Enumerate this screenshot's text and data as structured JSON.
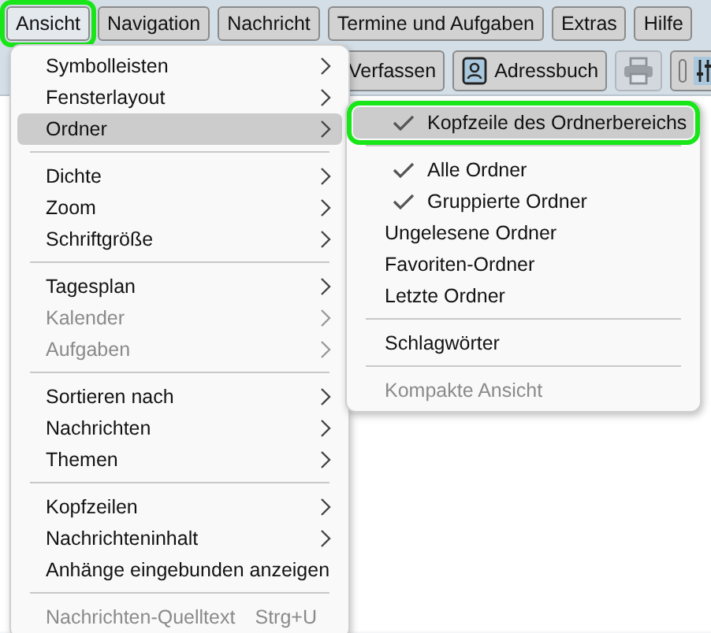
{
  "menubar": [
    {
      "label": "Ansicht",
      "selected": true,
      "outlined": true
    },
    {
      "label": "Navigation",
      "selected": false,
      "outlined": false
    },
    {
      "label": "Nachricht",
      "selected": false,
      "outlined": false
    },
    {
      "label": "Termine und Aufgaben",
      "selected": false,
      "outlined": false
    },
    {
      "label": "Extras",
      "selected": false,
      "outlined": false
    },
    {
      "label": "Hilfe",
      "selected": false,
      "outlined": false
    }
  ],
  "toolbar": [
    {
      "kind": "text",
      "label": "Verfassen",
      "disabled": false
    },
    {
      "kind": "addressbook",
      "label": "Adressbuch",
      "disabled": false
    },
    {
      "kind": "print",
      "disabled": true
    },
    {
      "kind": "filters",
      "disabled": false
    }
  ],
  "menu": [
    {
      "kind": "item",
      "label": "Symbolleisten",
      "submenu": true,
      "disabled": false,
      "selected": false
    },
    {
      "kind": "item",
      "label": "Fensterlayout",
      "submenu": true,
      "disabled": false,
      "selected": false
    },
    {
      "kind": "item",
      "label": "Ordner",
      "submenu": true,
      "disabled": false,
      "selected": true
    },
    {
      "kind": "separator"
    },
    {
      "kind": "item",
      "label": "Dichte",
      "submenu": true,
      "disabled": false,
      "selected": false
    },
    {
      "kind": "item",
      "label": "Zoom",
      "submenu": true,
      "disabled": false,
      "selected": false
    },
    {
      "kind": "item",
      "label": "Schriftgröße",
      "submenu": true,
      "disabled": false,
      "selected": false
    },
    {
      "kind": "separator"
    },
    {
      "kind": "item",
      "label": "Tagesplan",
      "submenu": true,
      "disabled": false,
      "selected": false
    },
    {
      "kind": "item",
      "label": "Kalender",
      "submenu": true,
      "disabled": true,
      "selected": false
    },
    {
      "kind": "item",
      "label": "Aufgaben",
      "submenu": true,
      "disabled": true,
      "selected": false
    },
    {
      "kind": "separator"
    },
    {
      "kind": "item",
      "label": "Sortieren nach",
      "submenu": true,
      "disabled": false,
      "selected": false
    },
    {
      "kind": "item",
      "label": "Nachrichten",
      "submenu": true,
      "disabled": false,
      "selected": false
    },
    {
      "kind": "item",
      "label": "Themen",
      "submenu": true,
      "disabled": false,
      "selected": false
    },
    {
      "kind": "separator"
    },
    {
      "kind": "item",
      "label": "Kopfzeilen",
      "submenu": true,
      "disabled": false,
      "selected": false
    },
    {
      "kind": "item",
      "label": "Nachrichteninhalt",
      "submenu": true,
      "disabled": false,
      "selected": false
    },
    {
      "kind": "item",
      "label": "Anhänge eingebunden anzeigen",
      "submenu": false,
      "disabled": false,
      "selected": false
    },
    {
      "kind": "separator"
    },
    {
      "kind": "item",
      "label": "Nachrichten-Quelltext",
      "shortcut": "Strg+U",
      "submenu": false,
      "disabled": true,
      "selected": false
    }
  ],
  "submenu": [
    {
      "kind": "check",
      "label": "Kopfzeile des Ordnerbereichs",
      "checked": true,
      "disabled": false,
      "selected": true,
      "outlined": true
    },
    {
      "kind": "separator"
    },
    {
      "kind": "check",
      "label": "Alle Ordner",
      "checked": true,
      "disabled": false,
      "selected": false,
      "outlined": false
    },
    {
      "kind": "check",
      "label": "Gruppierte Ordner",
      "checked": true,
      "disabled": false,
      "selected": false,
      "outlined": false
    },
    {
      "kind": "plain",
      "label": "Ungelesene Ordner",
      "disabled": false,
      "selected": false,
      "outlined": false
    },
    {
      "kind": "plain",
      "label": "Favoriten-Ordner",
      "disabled": false,
      "selected": false,
      "outlined": false
    },
    {
      "kind": "plain",
      "label": "Letzte Ordner",
      "disabled": false,
      "selected": false,
      "outlined": false
    },
    {
      "kind": "separator"
    },
    {
      "kind": "plain",
      "label": "Schlagwörter",
      "disabled": false,
      "selected": false,
      "outlined": false
    },
    {
      "kind": "separator"
    },
    {
      "kind": "plain",
      "label": "Kompakte Ansicht",
      "disabled": true,
      "selected": false,
      "outlined": false
    }
  ]
}
